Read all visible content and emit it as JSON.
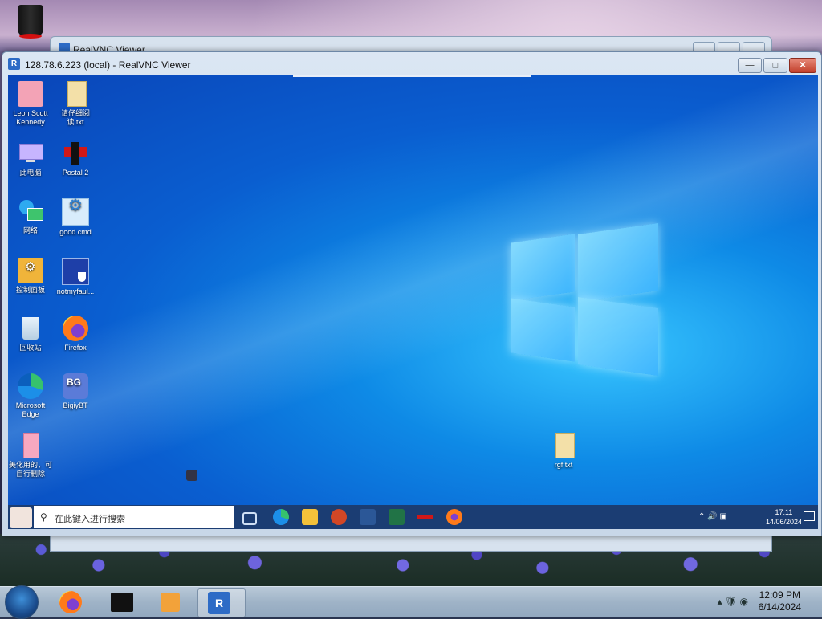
{
  "host": {
    "background_window_title": "RealVNC Viewer",
    "taskbar": {
      "clock_time": "12:09 PM",
      "clock_date": "6/14/2024"
    }
  },
  "vnc_window": {
    "title": "128.78.6.223 (local) - RealVNC Viewer",
    "app_icon_text": "R"
  },
  "remote_desktop": {
    "icons": [
      {
        "label": "Leon Scott Kennedy",
        "icon": "user-folder-icon"
      },
      {
        "label": "请仔细阅读.txt",
        "icon": "text-file-icon"
      },
      {
        "label": "此电脑",
        "icon": "computer-icon"
      },
      {
        "label": "Postal 2",
        "icon": "postal2-icon"
      },
      {
        "label": "网络",
        "icon": "network-icon"
      },
      {
        "label": "good.cmd",
        "icon": "cmd-gear-icon"
      },
      {
        "label": "控制面板",
        "icon": "control-panel-icon"
      },
      {
        "label": "notmyfaul...",
        "icon": "notmyfault-icon"
      },
      {
        "label": "回收站",
        "icon": "recycle-bin-icon"
      },
      {
        "label": "Firefox",
        "icon": "firefox-icon"
      },
      {
        "label": "Microsoft Edge",
        "icon": "edge-icon"
      },
      {
        "label": "BigiyBT",
        "icon": "bigiybt-icon"
      },
      {
        "label": "美化用的，可自行删除",
        "icon": "pink-folder-icon"
      },
      {
        "label": "rgf.txt",
        "icon": "text-file-icon"
      }
    ],
    "taskbar": {
      "search_placeholder": "在此键入进行搜索",
      "clock_time": "17:11",
      "clock_date": "14/06/2024"
    }
  },
  "colors": {
    "remote_taskbar": "#1b3d73",
    "wallpaper_blue": "#0e8ae6"
  }
}
